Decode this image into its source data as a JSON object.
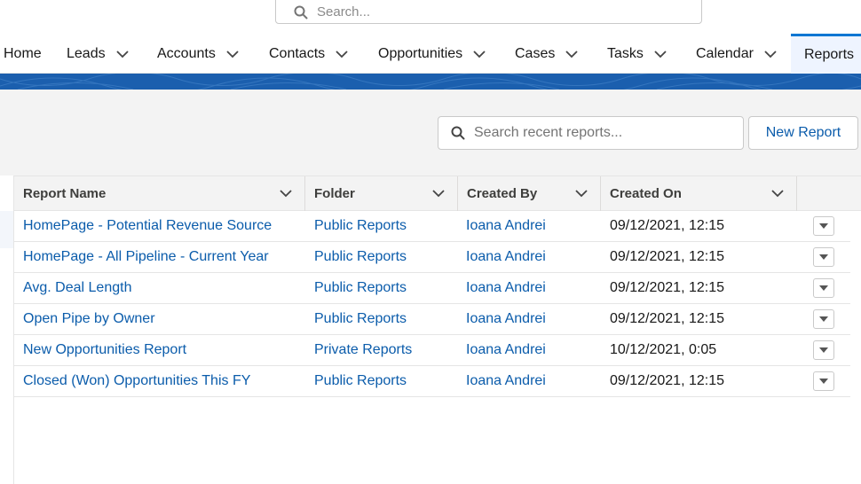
{
  "global_search": {
    "placeholder": "Search..."
  },
  "nav": {
    "items": [
      {
        "label": "Home"
      },
      {
        "label": "Leads"
      },
      {
        "label": "Accounts"
      },
      {
        "label": "Contacts"
      },
      {
        "label": "Opportunities"
      },
      {
        "label": "Cases"
      },
      {
        "label": "Tasks"
      },
      {
        "label": "Calendar"
      },
      {
        "label": "Reports"
      }
    ]
  },
  "reports": {
    "search_placeholder": "Search recent reports...",
    "new_report_label": "New Report",
    "columns": [
      "Report Name",
      "Folder",
      "Created By",
      "Created On"
    ],
    "rows": [
      {
        "name": "HomePage - Potential Revenue Source",
        "folder": "Public Reports",
        "created_by": "Ioana Andrei",
        "created_on": "09/12/2021, 12:15"
      },
      {
        "name": "HomePage - All Pipeline - Current Year",
        "folder": "Public Reports",
        "created_by": "Ioana Andrei",
        "created_on": "09/12/2021, 12:15"
      },
      {
        "name": "Avg. Deal Length",
        "folder": "Public Reports",
        "created_by": "Ioana Andrei",
        "created_on": "09/12/2021, 12:15"
      },
      {
        "name": "Open Pipe by Owner",
        "folder": "Public Reports",
        "created_by": "Ioana Andrei",
        "created_on": "09/12/2021, 12:15"
      },
      {
        "name": "New Opportunities Report",
        "folder": "Private Reports",
        "created_by": "Ioana Andrei",
        "created_on": "10/12/2021, 0:05"
      },
      {
        "name": "Closed (Won) Opportunities This FY",
        "folder": "Public Reports",
        "created_by": "Ioana Andrei",
        "created_on": "09/12/2021, 12:15"
      }
    ]
  },
  "colors": {
    "link": "#0b5cab",
    "brand_band": "#1b5fae",
    "active_tab_border": "#0176d3"
  },
  "icons": {
    "search": "search-icon",
    "chevron": "chevron-down-icon",
    "row_menu": "caret-down-icon"
  }
}
